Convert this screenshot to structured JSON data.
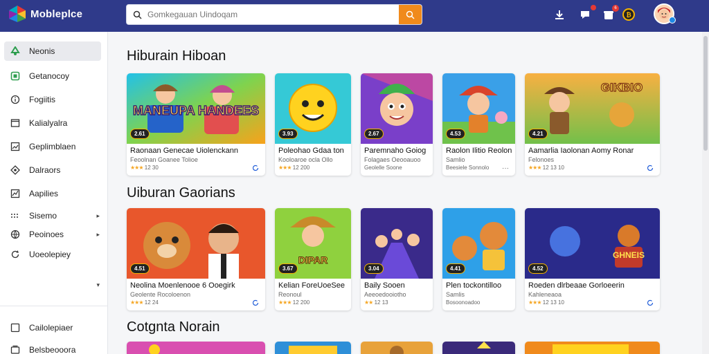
{
  "app": {
    "name": "Mobleplce",
    "colors": {
      "header_bg": "#2f3a8a",
      "accent": "#f08a1c",
      "page_bg": "#f5f6f8"
    }
  },
  "search": {
    "placeholder": "Gomkegauan Uindoqam",
    "icon": "search-icon"
  },
  "header_icons": [
    {
      "name": "download-icon"
    },
    {
      "name": "chat-icon",
      "badge": ""
    },
    {
      "name": "gift-icon",
      "badge": "6"
    },
    {
      "name": "coin-icon"
    }
  ],
  "sidebar": {
    "items": [
      {
        "label": "Neonis",
        "icon": "recycle-icon",
        "active": true
      },
      {
        "label": "Getanocoy",
        "icon": "square-icon"
      },
      {
        "label": "Fogiitis",
        "icon": "info-icon"
      },
      {
        "label": "Kalialyalra",
        "icon": "window-icon"
      },
      {
        "label": "Geplimblaen",
        "icon": "image-icon"
      },
      {
        "label": "Dalraors",
        "icon": "diamond-icon"
      },
      {
        "label": "Aapilies",
        "icon": "chart-icon"
      },
      {
        "label": "Sisemo",
        "icon": "dots-icon",
        "chevron": "▸"
      },
      {
        "label": "Peoinoes",
        "icon": "globe-icon",
        "chevron": "▸"
      },
      {
        "label": "Uoeolepiey",
        "icon": "refresh-icon"
      },
      {
        "label": "",
        "icon": "",
        "chevron": "▾"
      }
    ],
    "bottom_items": [
      {
        "label": "Cailolepiaer",
        "icon": "square-icon"
      },
      {
        "label": "Belsbeooora",
        "icon": "layers-icon"
      }
    ]
  },
  "sections": [
    {
      "title": "Hiburain Hiboan",
      "cards": [
        {
          "title": "Raonaan Genecae Uiolenckann",
          "sub": "Feoolnan Goanee Tolioe",
          "rating": "★★★",
          "meta": "12 30",
          "chip": "2.61"
        },
        {
          "title": "Poleohao Gdaa ton",
          "sub": "Kooloaroe ocla Ollo",
          "rating": "★★★",
          "meta": "12 200",
          "chip": "3.93"
        },
        {
          "title": "Paremnaho Goiog",
          "sub": "Folagaes Oeooauoo",
          "rating": "",
          "meta": "Geolelle Soone",
          "chip": "2.67"
        },
        {
          "title": "Raolon Ilitio Reolon",
          "sub": "Samlio",
          "rating": "",
          "meta": "Beesiele Sonnolo",
          "chip": "4.53"
        },
        {
          "title": "Aamarlia Iaolonan Aomy Ronar",
          "sub": "Felonoes",
          "rating": "★★★",
          "meta": "12 13 10",
          "chip": "4.21"
        }
      ]
    },
    {
      "title": "Uiburan Gaorians",
      "cards": [
        {
          "title": "Neolina Moenlenooe 6 Ooegirk",
          "sub": "Geolente Rocoloenon",
          "rating": "★★★",
          "meta": "12 24",
          "chip": "4.51"
        },
        {
          "title": "Kelian ForeUoeSee",
          "sub": "Reonoul",
          "rating": "★★★",
          "meta": "12 200",
          "chip": "3.67"
        },
        {
          "title": "Baily Sooen",
          "sub": "Aeeoedooiotho",
          "rating": "★★",
          "meta": "12 13",
          "chip": "3.04"
        },
        {
          "title": "Plen tockontilloo",
          "sub": "Samlis",
          "rating": "",
          "meta": "Bosoonoadoo",
          "chip": "4.41"
        },
        {
          "title": "Roeden dlrbeaae Gorloeerin",
          "sub": "Kahleneaoa",
          "rating": "★★★",
          "meta": "12 13 10",
          "chip": "4.52"
        }
      ]
    },
    {
      "title": "Cotgnta Norain",
      "cards": []
    }
  ]
}
